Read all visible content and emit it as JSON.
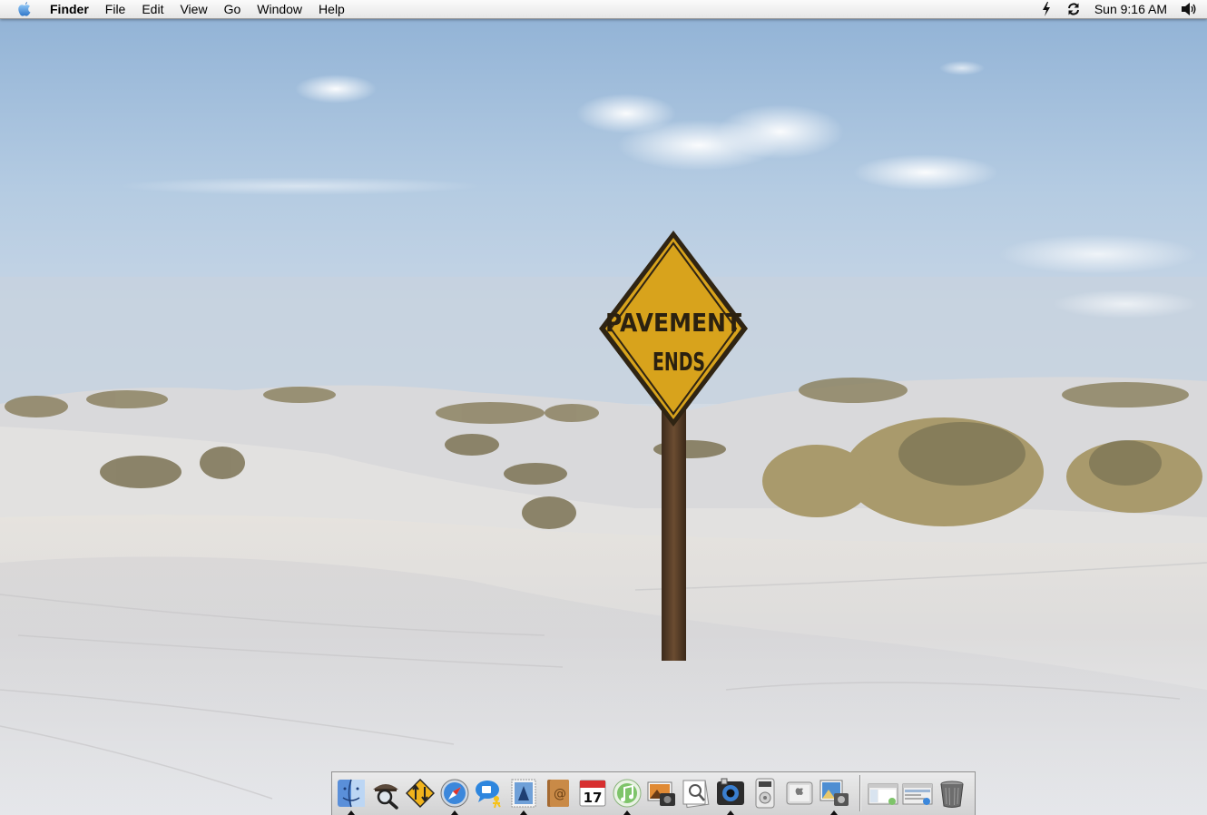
{
  "menubar": {
    "apple_icon": "apple-logo-icon",
    "app_name": "Finder",
    "items": [
      "File",
      "Edit",
      "View",
      "Go",
      "Window",
      "Help"
    ],
    "extras": [
      "battery-power-icon",
      "sync-icon"
    ],
    "clock": "Sun 9:16 AM",
    "volume_icon": "speaker-volume-icon"
  },
  "desktop": {
    "wallpaper": "white sand dunes with yellow road sign",
    "sign_text_line1": "PAVEMENT",
    "sign_text_line2": "ENDS"
  },
  "dock": {
    "apps": [
      {
        "name": "finder-icon",
        "running": true
      },
      {
        "name": "sherlock-icon",
        "running": false
      },
      {
        "name": "network-utility-icon",
        "running": false
      },
      {
        "name": "safari-compass-icon",
        "running": true
      },
      {
        "name": "ichat-icon",
        "running": false
      },
      {
        "name": "mail-stamp-icon",
        "running": true
      },
      {
        "name": "address-book-icon",
        "running": false
      },
      {
        "name": "ical-icon",
        "running": false,
        "label": "17"
      },
      {
        "name": "itunes-icon",
        "running": true
      },
      {
        "name": "iphoto-icon",
        "running": false
      },
      {
        "name": "preview-icon",
        "running": false
      },
      {
        "name": "quicktime-icon",
        "running": true
      },
      {
        "name": "dvd-player-icon",
        "running": false
      },
      {
        "name": "system-preferences-icon",
        "running": false
      },
      {
        "name": "image-capture-icon",
        "running": true
      }
    ],
    "docs": [
      {
        "name": "minimized-itunes-window-icon"
      },
      {
        "name": "minimized-web-window-icon"
      },
      {
        "name": "trash-icon"
      }
    ]
  },
  "colors": {
    "sky_top": "#9ab8d8",
    "sky_bottom": "#c9d8e6",
    "sand": "#e7e8ea",
    "sign_yellow": "#d8a31c"
  }
}
